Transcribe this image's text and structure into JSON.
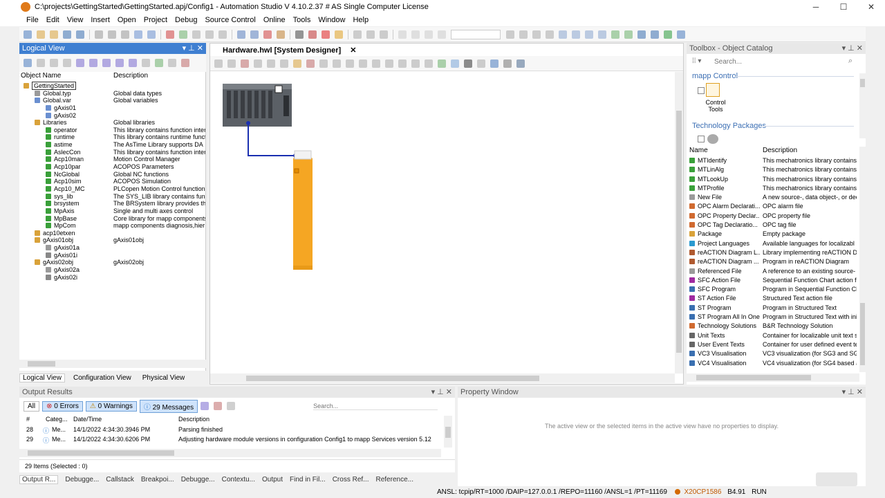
{
  "window": {
    "title": "C:\\projects\\GettingStarted\\GettingStarted.apj/Config1 - Automation Studio V 4.10.2.37 # AS Single Computer License",
    "minimize": "─",
    "maximize": "☐",
    "close": "✕"
  },
  "menu": [
    "File",
    "Edit",
    "View",
    "Insert",
    "Open",
    "Project",
    "Debug",
    "Source Control",
    "Online",
    "Tools",
    "Window",
    "Help"
  ],
  "logical_view": {
    "title": "Logical View",
    "col_name": "Object Name",
    "col_desc": "Description",
    "items": [
      {
        "name": "GettingStarted",
        "desc": "",
        "indent": 0,
        "icon": "folder"
      },
      {
        "name": "Global.typ",
        "desc": "Global data types",
        "indent": 1,
        "icon": "file"
      },
      {
        "name": "Global.var",
        "desc": "Global variables",
        "indent": 1,
        "icon": "var"
      },
      {
        "name": "gAxis01",
        "desc": "",
        "indent": 2,
        "icon": "var"
      },
      {
        "name": "gAxis02",
        "desc": "",
        "indent": 2,
        "icon": "var"
      },
      {
        "name": "Libraries",
        "desc": "Global libraries",
        "indent": 1,
        "icon": "folder"
      },
      {
        "name": "operator",
        "desc": "This library contains function interf",
        "indent": 2,
        "icon": "lib"
      },
      {
        "name": "runtime",
        "desc": "This library contains runtime functi",
        "indent": 2,
        "icon": "lib"
      },
      {
        "name": "astime",
        "desc": "The AsTime Library supports DA",
        "indent": 2,
        "icon": "lib"
      },
      {
        "name": "AslecCon",
        "desc": "This library contains function interf",
        "indent": 2,
        "icon": "lib"
      },
      {
        "name": "Acp10man",
        "desc": "Motion Control Manager",
        "indent": 2,
        "icon": "lib"
      },
      {
        "name": "Acp10par",
        "desc": "ACOPOS Parameters",
        "indent": 2,
        "icon": "lib"
      },
      {
        "name": "NcGlobal",
        "desc": "Global NC functions",
        "indent": 2,
        "icon": "lib"
      },
      {
        "name": "Acp10sim",
        "desc": "ACOPOS Simulation",
        "indent": 2,
        "icon": "lib"
      },
      {
        "name": "Acp10_MC",
        "desc": "PLCopen Motion Control function b",
        "indent": 2,
        "icon": "lib"
      },
      {
        "name": "sys_lib",
        "desc": "The SYS_LIB library contains func",
        "indent": 2,
        "icon": "lib"
      },
      {
        "name": "brsystem",
        "desc": "The BRSystem library provides th",
        "indent": 2,
        "icon": "lib"
      },
      {
        "name": "MpAxis",
        "desc": "Single and multi axes control",
        "indent": 2,
        "icon": "lib"
      },
      {
        "name": "MpBase",
        "desc": "Core library for mapp components",
        "indent": 2,
        "icon": "lib"
      },
      {
        "name": "MpCom",
        "desc": "mapp components diagnosis,hier",
        "indent": 2,
        "icon": "lib"
      },
      {
        "name": "acp10etxen",
        "desc": "",
        "indent": 1,
        "icon": "folder"
      },
      {
        "name": "gAxis01obj",
        "desc": "gAxis01obj",
        "indent": 1,
        "icon": "folder"
      },
      {
        "name": "gAxis01a",
        "desc": "",
        "indent": 2,
        "icon": "file"
      },
      {
        "name": "gAxis01i",
        "desc": "",
        "indent": 2,
        "icon": "gear"
      },
      {
        "name": "gAxis02obj",
        "desc": "gAxis02obj",
        "indent": 1,
        "icon": "folder"
      },
      {
        "name": "gAxis02a",
        "desc": "",
        "indent": 2,
        "icon": "file"
      },
      {
        "name": "gAxis02i",
        "desc": "",
        "indent": 2,
        "icon": "gear"
      }
    ],
    "tabs": [
      "Logical View",
      "Configuration View",
      "Physical View"
    ]
  },
  "editor": {
    "tab": "Hardware.hwl [System Designer]"
  },
  "toolbox": {
    "title": "Toolbox - Object Catalog",
    "search_placeholder": "Search...",
    "cat1": "mapp Control",
    "cat1_item": "Control Tools",
    "cat2": "Technology Packages",
    "col_name": "Name",
    "col_desc": "Description",
    "items": [
      {
        "name": "MTIdentify",
        "desc": "This mechatronics library contains",
        "icon": "lib"
      },
      {
        "name": "MTLinAlg",
        "desc": "This mechatronics library contains",
        "icon": "lib"
      },
      {
        "name": "MTLookUp",
        "desc": "This mechatronics library contains",
        "icon": "lib"
      },
      {
        "name": "MTProfile",
        "desc": "This mechatronics library contains",
        "icon": "lib"
      },
      {
        "name": "New File",
        "desc": "A new source-, data object-, or decla",
        "icon": "file"
      },
      {
        "name": "OPC Alarm Declarati...",
        "desc": "OPC alarm file",
        "icon": "opc"
      },
      {
        "name": "OPC Property Declar...",
        "desc": "OPC property file",
        "icon": "opc"
      },
      {
        "name": "OPC Tag Declaratio...",
        "desc": "OPC tag file",
        "icon": "opc"
      },
      {
        "name": "Package",
        "desc": "Empty package",
        "icon": "folder"
      },
      {
        "name": "Project Languages",
        "desc": "Available languages for localizabl",
        "icon": "globe"
      },
      {
        "name": "reACTION Diagram L...",
        "desc": "Library implementing reACTION D",
        "icon": "react"
      },
      {
        "name": "reACTION Diagram ...",
        "desc": "Program in reACTION Diagram",
        "icon": "react"
      },
      {
        "name": "Referenced File",
        "desc": "A reference to an existing source-",
        "icon": "file"
      },
      {
        "name": "SFC Action File",
        "desc": "Sequential Function Chart action fil",
        "icon": "sfc"
      },
      {
        "name": "SFC Program",
        "desc": "Program in Sequential Function Ch",
        "icon": "prog"
      },
      {
        "name": "ST Action File",
        "desc": "Structured Text action file",
        "icon": "sfc"
      },
      {
        "name": "ST Program",
        "desc": "Program in Structured Text",
        "icon": "prog"
      },
      {
        "name": "ST Program All In One",
        "desc": "Program in Structured Text with init,",
        "icon": "prog"
      },
      {
        "name": "Technology Solutions",
        "desc": "B&R Technology Solution",
        "icon": "opc"
      },
      {
        "name": "Unit Texts",
        "desc": "Container for localizable unit text st",
        "icon": "text"
      },
      {
        "name": "User Event Texts",
        "desc": "Container for user defined event te",
        "icon": "text"
      },
      {
        "name": "VC3 Visualisation",
        "desc": "VC3 visualization (for SG3 and SG",
        "icon": "vc"
      },
      {
        "name": "VC4 Visualisation",
        "desc": "VC4 visualization (for SG4 based a",
        "icon": "vc"
      }
    ]
  },
  "output": {
    "title": "Output Results",
    "all": "All",
    "errors": "0 Errors",
    "warnings": "0 Warnings",
    "messages": "29 Messages",
    "search_placeholder": "Search...",
    "cols": [
      "#",
      "Categ...",
      "Date/Time",
      "Description"
    ],
    "rows": [
      {
        "num": "28",
        "cat": "Me...",
        "time": "14/1/2022 4:34:30.3946 PM",
        "desc": "Parsing finished"
      },
      {
        "num": "29",
        "cat": "Me...",
        "time": "14/1/2022 4:34:30.6206 PM",
        "desc": "Adjusting hardware module versions in configuration Config1 to mapp Services version 5.12"
      }
    ],
    "status": "29 Items (Selected : 0)",
    "tabs": [
      "Output R...",
      "Debugge...",
      "Callstack",
      "Breakpoi...",
      "Debugge...",
      "Contextu...",
      "Output",
      "Find in Fil...",
      "Cross Ref...",
      "Reference..."
    ]
  },
  "property": {
    "title": "Property Window",
    "message": "The active view or the selected items in the active view have no properties to display."
  },
  "status": {
    "connection": "ANSL: tcpip/RT=1000 /DAIP=127.0.0.1 /REPO=11160 /ANSL=1 /PT=11169",
    "cpu": "X20CP1586",
    "version": "B4.91",
    "mode": "RUN"
  },
  "colors": {
    "accent": "#3f7fd1",
    "module_orange": "#f5a623",
    "cpu_dark": "#555a60",
    "link": "#1a2fb0"
  }
}
